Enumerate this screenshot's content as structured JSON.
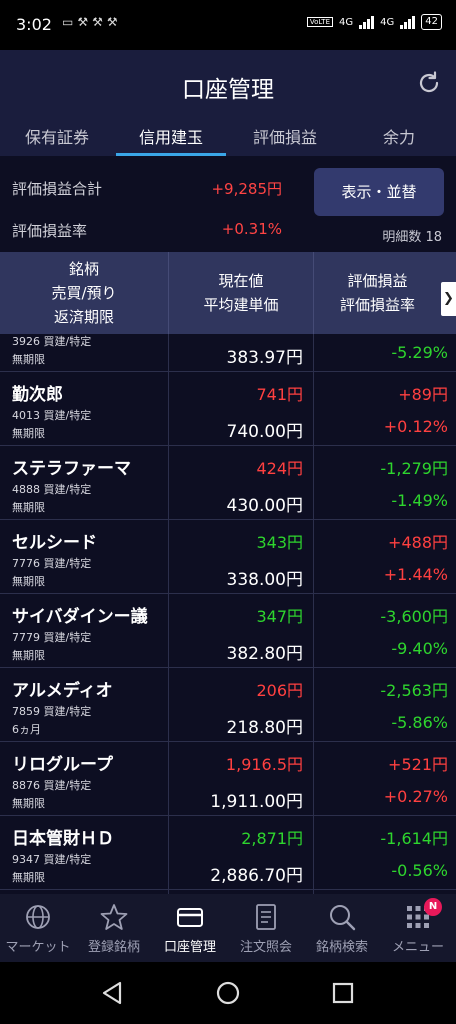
{
  "status_bar": {
    "time": "3:02",
    "notif_icons": [
      "line-icon",
      "hammer-icon",
      "hammer-icon",
      "hammer-icon"
    ],
    "net": "4G",
    "net2": "4G",
    "volte": "VoLTE",
    "battery": "42"
  },
  "header": {
    "title": "口座管理"
  },
  "tabs": [
    {
      "label": "保有証券",
      "active": false
    },
    {
      "label": "信用建玉",
      "active": true
    },
    {
      "label": "評価損益",
      "active": false
    },
    {
      "label": "余力",
      "active": false
    }
  ],
  "summary": {
    "total_label": "評価損益合計",
    "total_value": "+9,285円",
    "rate_label": "評価損益率",
    "rate_value": "+0.31%",
    "display_button": "表示・並替",
    "count_label": "明細数 18"
  },
  "table": {
    "headers": {
      "col1": [
        "銘柄",
        "売買/預り",
        "返済期限"
      ],
      "col2": [
        "現在値",
        "平均建単価"
      ],
      "col3": [
        "評価損益",
        "評価損益率"
      ]
    },
    "rows": [
      {
        "name": "",
        "code": "3926 買建/特定",
        "expiry": "無期限",
        "current": "",
        "current_color": "red",
        "avg": "383.97円",
        "pl": "",
        "pl_color": "green",
        "rate": "-5.29%",
        "rate_color": "green"
      },
      {
        "name": "勤次郎",
        "code": "4013 買建/特定",
        "expiry": "無期限",
        "current": "741円",
        "current_color": "red",
        "avg": "740.00円",
        "pl": "+89円",
        "pl_color": "red",
        "rate": "+0.12%",
        "rate_color": "red"
      },
      {
        "name": "ステラファーマ",
        "code": "4888 買建/特定",
        "expiry": "無期限",
        "current": "424円",
        "current_color": "red",
        "avg": "430.00円",
        "pl": "-1,279円",
        "pl_color": "green",
        "rate": "-1.49%",
        "rate_color": "green"
      },
      {
        "name": "セルシード",
        "code": "7776 買建/特定",
        "expiry": "無期限",
        "current": "343円",
        "current_color": "green",
        "avg": "338.00円",
        "pl": "+488円",
        "pl_color": "red",
        "rate": "+1.44%",
        "rate_color": "red"
      },
      {
        "name": "サイバダインー議",
        "code": "7779 買建/特定",
        "expiry": "無期限",
        "current": "347円",
        "current_color": "green",
        "avg": "382.80円",
        "pl": "-3,600円",
        "pl_color": "green",
        "rate": "-9.40%",
        "rate_color": "green"
      },
      {
        "name": "アルメディオ",
        "code": "7859 買建/特定",
        "expiry": "6ヵ月",
        "current": "206円",
        "current_color": "red",
        "avg": "218.80円",
        "pl": "-2,563円",
        "pl_color": "green",
        "rate": "-5.86%",
        "rate_color": "green"
      },
      {
        "name": "リログループ",
        "code": "8876 買建/特定",
        "expiry": "無期限",
        "current": "1,916.5円",
        "current_color": "red",
        "avg": "1,911.00円",
        "pl": "+521円",
        "pl_color": "red",
        "rate": "+0.27%",
        "rate_color": "red"
      },
      {
        "name": "日本管財ＨＤ",
        "code": "9347 買建/特定",
        "expiry": "無期限",
        "current": "2,871円",
        "current_color": "green",
        "avg": "2,886.70円",
        "pl": "-1,614円",
        "pl_color": "green",
        "rate": "-0.56%",
        "rate_color": "green"
      }
    ]
  },
  "bottom_nav": [
    {
      "label": "マーケット",
      "icon": "globe-icon",
      "active": false
    },
    {
      "label": "登録銘柄",
      "icon": "star-icon",
      "active": false
    },
    {
      "label": "口座管理",
      "icon": "card-icon",
      "active": true
    },
    {
      "label": "注文照会",
      "icon": "document-icon",
      "active": false
    },
    {
      "label": "銘柄検索",
      "icon": "search-icon",
      "active": false
    },
    {
      "label": "メニュー",
      "icon": "grid-icon",
      "active": false,
      "badge": "N"
    }
  ],
  "colors": {
    "red": "#ff4040",
    "green": "#2ed52e",
    "header_bg": "#1a1d3d",
    "accent": "#3aa6e8"
  }
}
